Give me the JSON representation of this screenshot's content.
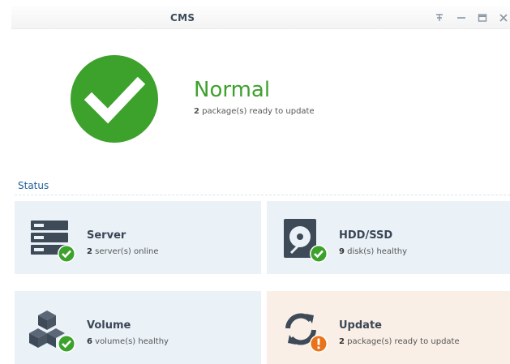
{
  "window": {
    "title": "CMS",
    "controls": [
      "pin-icon",
      "minimize-icon",
      "maximize-icon",
      "close-icon"
    ]
  },
  "overview": {
    "status": "Normal",
    "status_color": "#3da22c",
    "detail_count": "2",
    "detail_text": " package(s) ready to update"
  },
  "section": {
    "label": "Status"
  },
  "tiles": [
    {
      "name": "Server",
      "count": "2",
      "text": " server(s) online",
      "icon": "server-icon",
      "badge": "ok"
    },
    {
      "name": "HDD/SSD",
      "count": "9",
      "text": " disk(s) healthy",
      "icon": "hdd-icon",
      "badge": "ok"
    },
    {
      "name": "Volume",
      "count": "6",
      "text": " volume(s) healthy",
      "icon": "volume-icon",
      "badge": "ok"
    },
    {
      "name": "Update",
      "count": "2",
      "text": " package(s) ready to update",
      "icon": "update-icon",
      "badge": "warning"
    }
  ],
  "colors": {
    "ok": "#3da22c",
    "warning": "#e8731a",
    "tile_bg": "#eaf2f8",
    "tile_warn_bg": "#faefe6",
    "accent_text": "#1f5f9a"
  }
}
